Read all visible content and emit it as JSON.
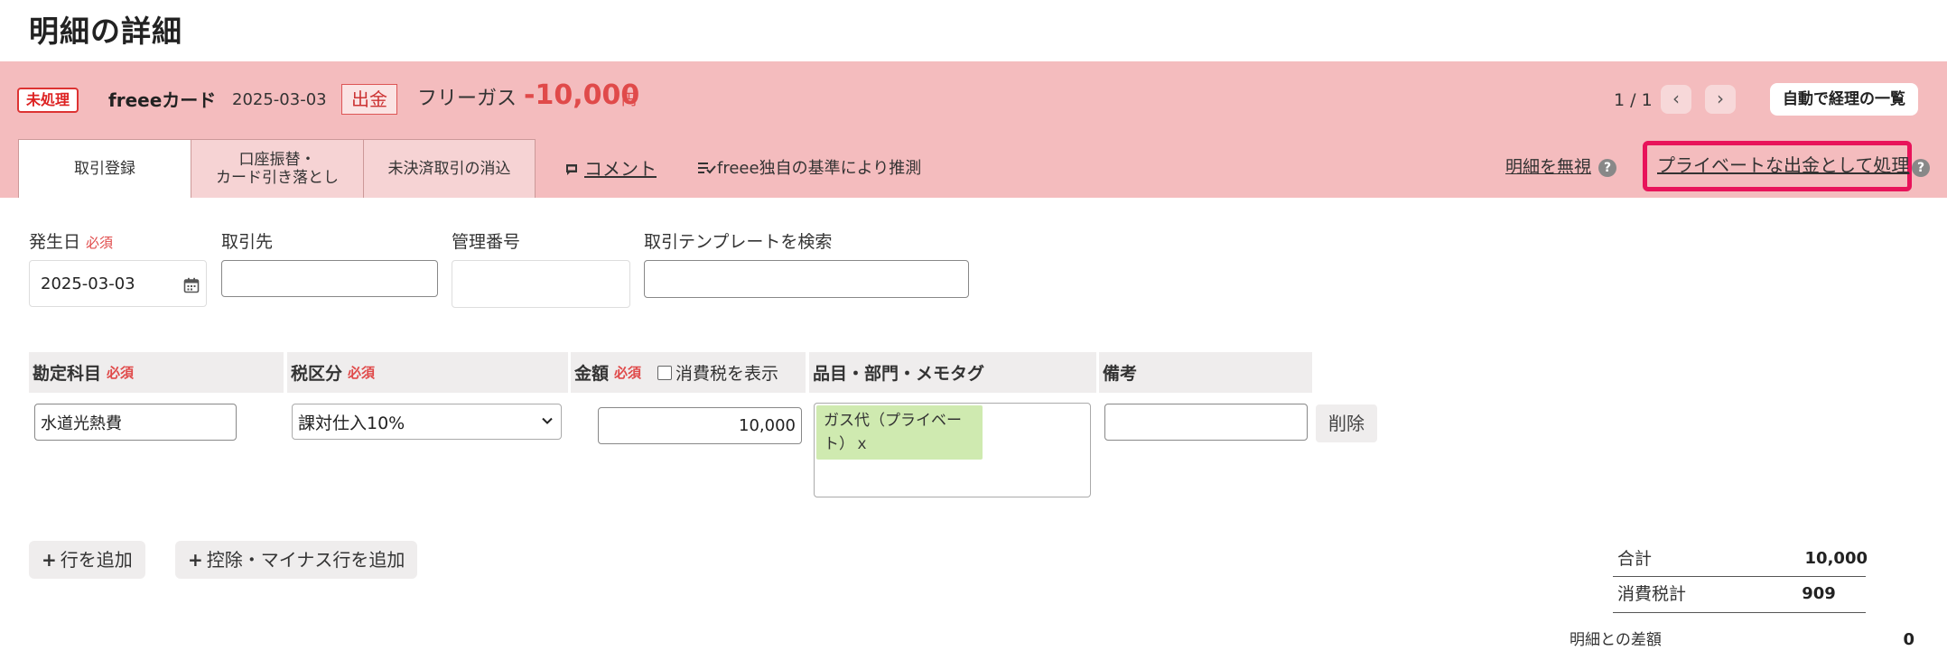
{
  "page_title": "明細の詳細",
  "header": {
    "status_badge": "未処理",
    "card_name": "freeeカード",
    "date": "2025-03-03",
    "direction_badge": "出金",
    "partner": "フリーガス",
    "amount": "-10,000",
    "currency": "円",
    "pager": "1 / 1",
    "prev_icon": "‹",
    "next_icon": "›",
    "auto_button": "自動で経理の一覧"
  },
  "tabs": [
    {
      "label": "取引登録"
    },
    {
      "label": "口座振替・\nカード引き落とし"
    },
    {
      "label": "未決済取引の消込"
    }
  ],
  "links": {
    "comment": "コメント",
    "guess": "freee独自の基準により推測",
    "ignore": "明細を無視",
    "private": "プライベートな出金として処理",
    "help": "?"
  },
  "form": {
    "date_label": "発生日",
    "required": "必須",
    "date_value": "2025-03-03",
    "partner_label": "取引先",
    "partner_value": "",
    "manage_label": "管理番号",
    "manage_value": "",
    "template_label": "取引テンプレートを検索",
    "template_value": ""
  },
  "table": {
    "headers": {
      "account": "勘定科目",
      "tax": "税区分",
      "amount": "金額",
      "show_tax": "消費税を表示",
      "items": "品目・部門・メモタグ",
      "note": "備考"
    },
    "row": {
      "account": "水道光熱費",
      "tax": "課対仕入10%",
      "amount": "10,000",
      "tag": "ガス代（プライベート）ｘ",
      "note": "",
      "delete": "削除"
    }
  },
  "actions": {
    "add_row": "行を追加",
    "add_minus_row": "控除・マイナス行を追加",
    "plus": "+"
  },
  "summary": {
    "total_label": "合計",
    "total_value": "10,000",
    "tax_label": "消費税計",
    "tax_value": "909",
    "diff_label": "明細との差額",
    "diff_value": "0"
  },
  "colors": {
    "banner": "#f4bcbe",
    "highlight": "#e8135a",
    "amount": "#e04a4a",
    "tag": "#cfeab0"
  }
}
